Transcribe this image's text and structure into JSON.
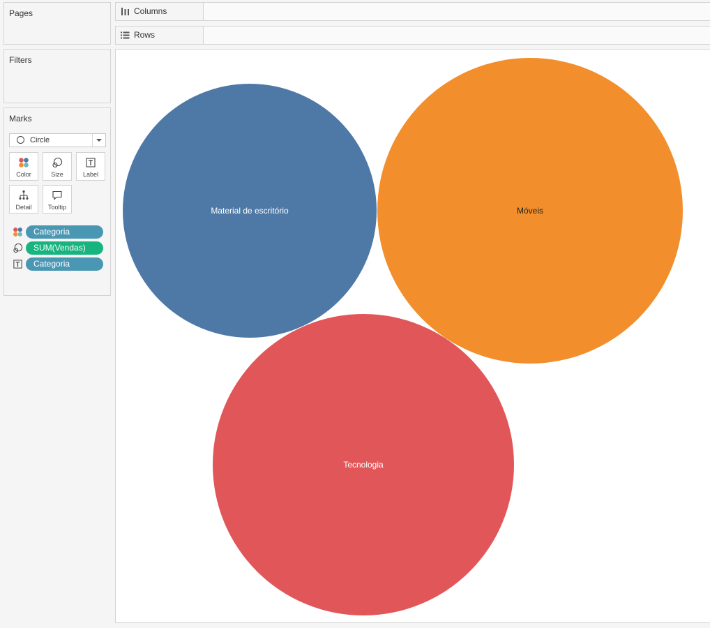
{
  "pages": {
    "title": "Pages"
  },
  "filters": {
    "title": "Filters"
  },
  "marks": {
    "title": "Marks",
    "mark_type": "Circle",
    "buttons": {
      "color": "Color",
      "size": "Size",
      "label": "Label",
      "detail": "Detail",
      "tooltip": "Tooltip"
    },
    "pills": [
      {
        "icon": "color-icon",
        "label": "Categoria",
        "color": "#4a97b4"
      },
      {
        "icon": "size-icon",
        "label": "SUM(Vendas)",
        "color": "#17b480"
      },
      {
        "icon": "label-icon",
        "label": "Categoria",
        "color": "#4a97b4"
      }
    ]
  },
  "shelves": {
    "columns_label": "Columns",
    "rows_label": "Rows"
  },
  "chart_data": {
    "type": "packed-bubble",
    "size_measure": "SUM(Vendas)",
    "color_dimension": "Categoria",
    "categories": [
      "Material de escritório",
      "Móveis",
      "Tecnologia"
    ],
    "colors": [
      "#4e79a7",
      "#f28e2b",
      "#e15759"
    ],
    "label_colors": [
      "#ffffff",
      "#222222",
      "#ffffff"
    ],
    "relative_size": [
      0.7,
      1.0,
      0.98
    ]
  }
}
